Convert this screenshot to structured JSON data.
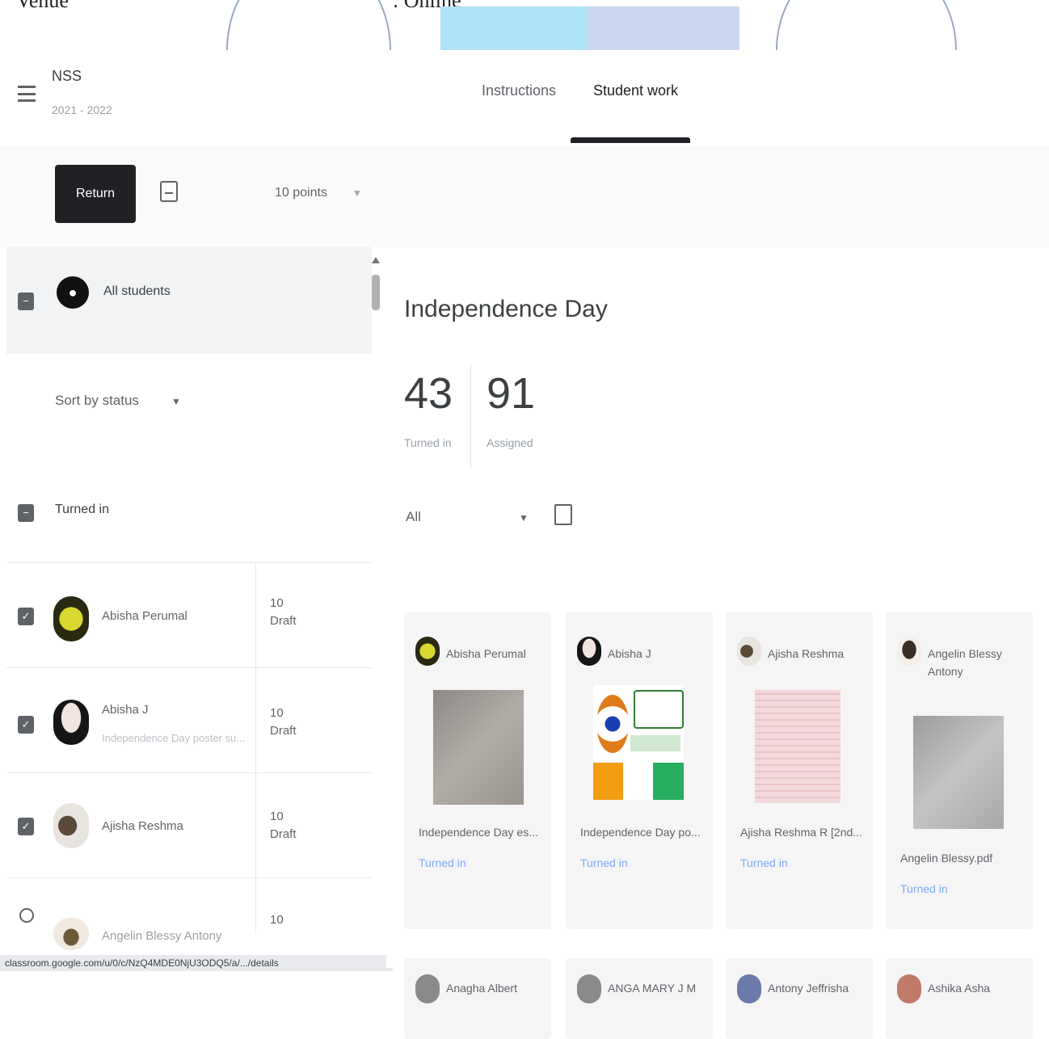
{
  "document": {
    "venue_label": "Venue",
    "venue_value": ": Online"
  },
  "header": {
    "class_name": "NSS",
    "class_year": "2021 - 2022",
    "tabs": [
      {
        "label": "Instructions"
      },
      {
        "label": "Student work"
      }
    ]
  },
  "toolbar": {
    "return_label": "Return",
    "points_label": "10 points"
  },
  "left_panel": {
    "all_students_label": "All students",
    "sort_label": "Sort by status",
    "group_label": "Turned in",
    "students": [
      {
        "name": "Abisha Perumal",
        "subtitle": "",
        "points": "10",
        "status": "Draft"
      },
      {
        "name": "Abisha J",
        "subtitle": "Independence Day poster su...",
        "points": "10",
        "status": "Draft"
      },
      {
        "name": "Ajisha Reshma",
        "subtitle": "",
        "points": "10",
        "status": "Draft"
      },
      {
        "name": "Angelin Blessy Antony",
        "subtitle": "",
        "points": "10",
        "status": ""
      }
    ],
    "status_url": "classroom.google.com/u/0/c/NzQ4MDE0NjU3ODQ5/a/.../details"
  },
  "main": {
    "assignment_title": "Independence Day",
    "turned_in_count": "43",
    "turned_in_label": "Turned in",
    "assigned_count": "91",
    "assigned_label": "Assigned",
    "filter_label": "All",
    "cards": [
      {
        "name": "Abisha Perumal",
        "file": "Independence Day es...",
        "status": "Turned in"
      },
      {
        "name": "Abisha J",
        "file": "Independence Day po...",
        "status": "Turned in"
      },
      {
        "name": "Ajisha Reshma",
        "file": "Ajisha Reshma R [2nd...",
        "status": "Turned in"
      },
      {
        "name": "Angelin Blessy Antony",
        "file": "Angelin Blessy.pdf",
        "status": "Turned in"
      }
    ],
    "cards_row2": [
      {
        "name": "Anagha Albert"
      },
      {
        "name": "ANGA MARY J M"
      },
      {
        "name": "Antony Jeffrisha"
      },
      {
        "name": "Ashika Asha"
      }
    ]
  },
  "colors": {
    "return_bg": "#1f2124",
    "turned_in_text": "#7baaf7",
    "card_bg": "#f5f5f5"
  }
}
